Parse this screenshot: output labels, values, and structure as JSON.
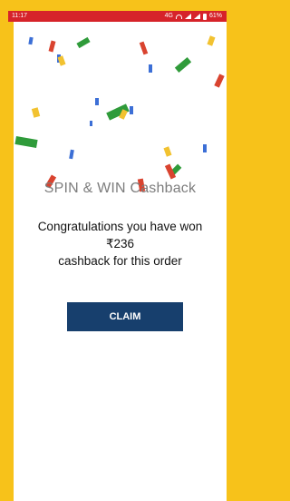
{
  "status_bar": {
    "time": "11:17",
    "network_text": "4G",
    "battery": "61%"
  },
  "dialog": {
    "title": "SPIN & WIN Cashback",
    "message_line1": "Congratulations you have won",
    "amount": "₹236",
    "message_line3": "cashback for this order",
    "claim_label": "CLAIM"
  },
  "colors": {
    "frame": "#f7c21a",
    "status_bar": "#d6232a",
    "claim_button": "#173f6d",
    "confetti_green": "#2f9b3a",
    "confetti_red": "#d9432f",
    "confetti_blue": "#3c6fd6",
    "confetti_yellow": "#f2c230"
  }
}
